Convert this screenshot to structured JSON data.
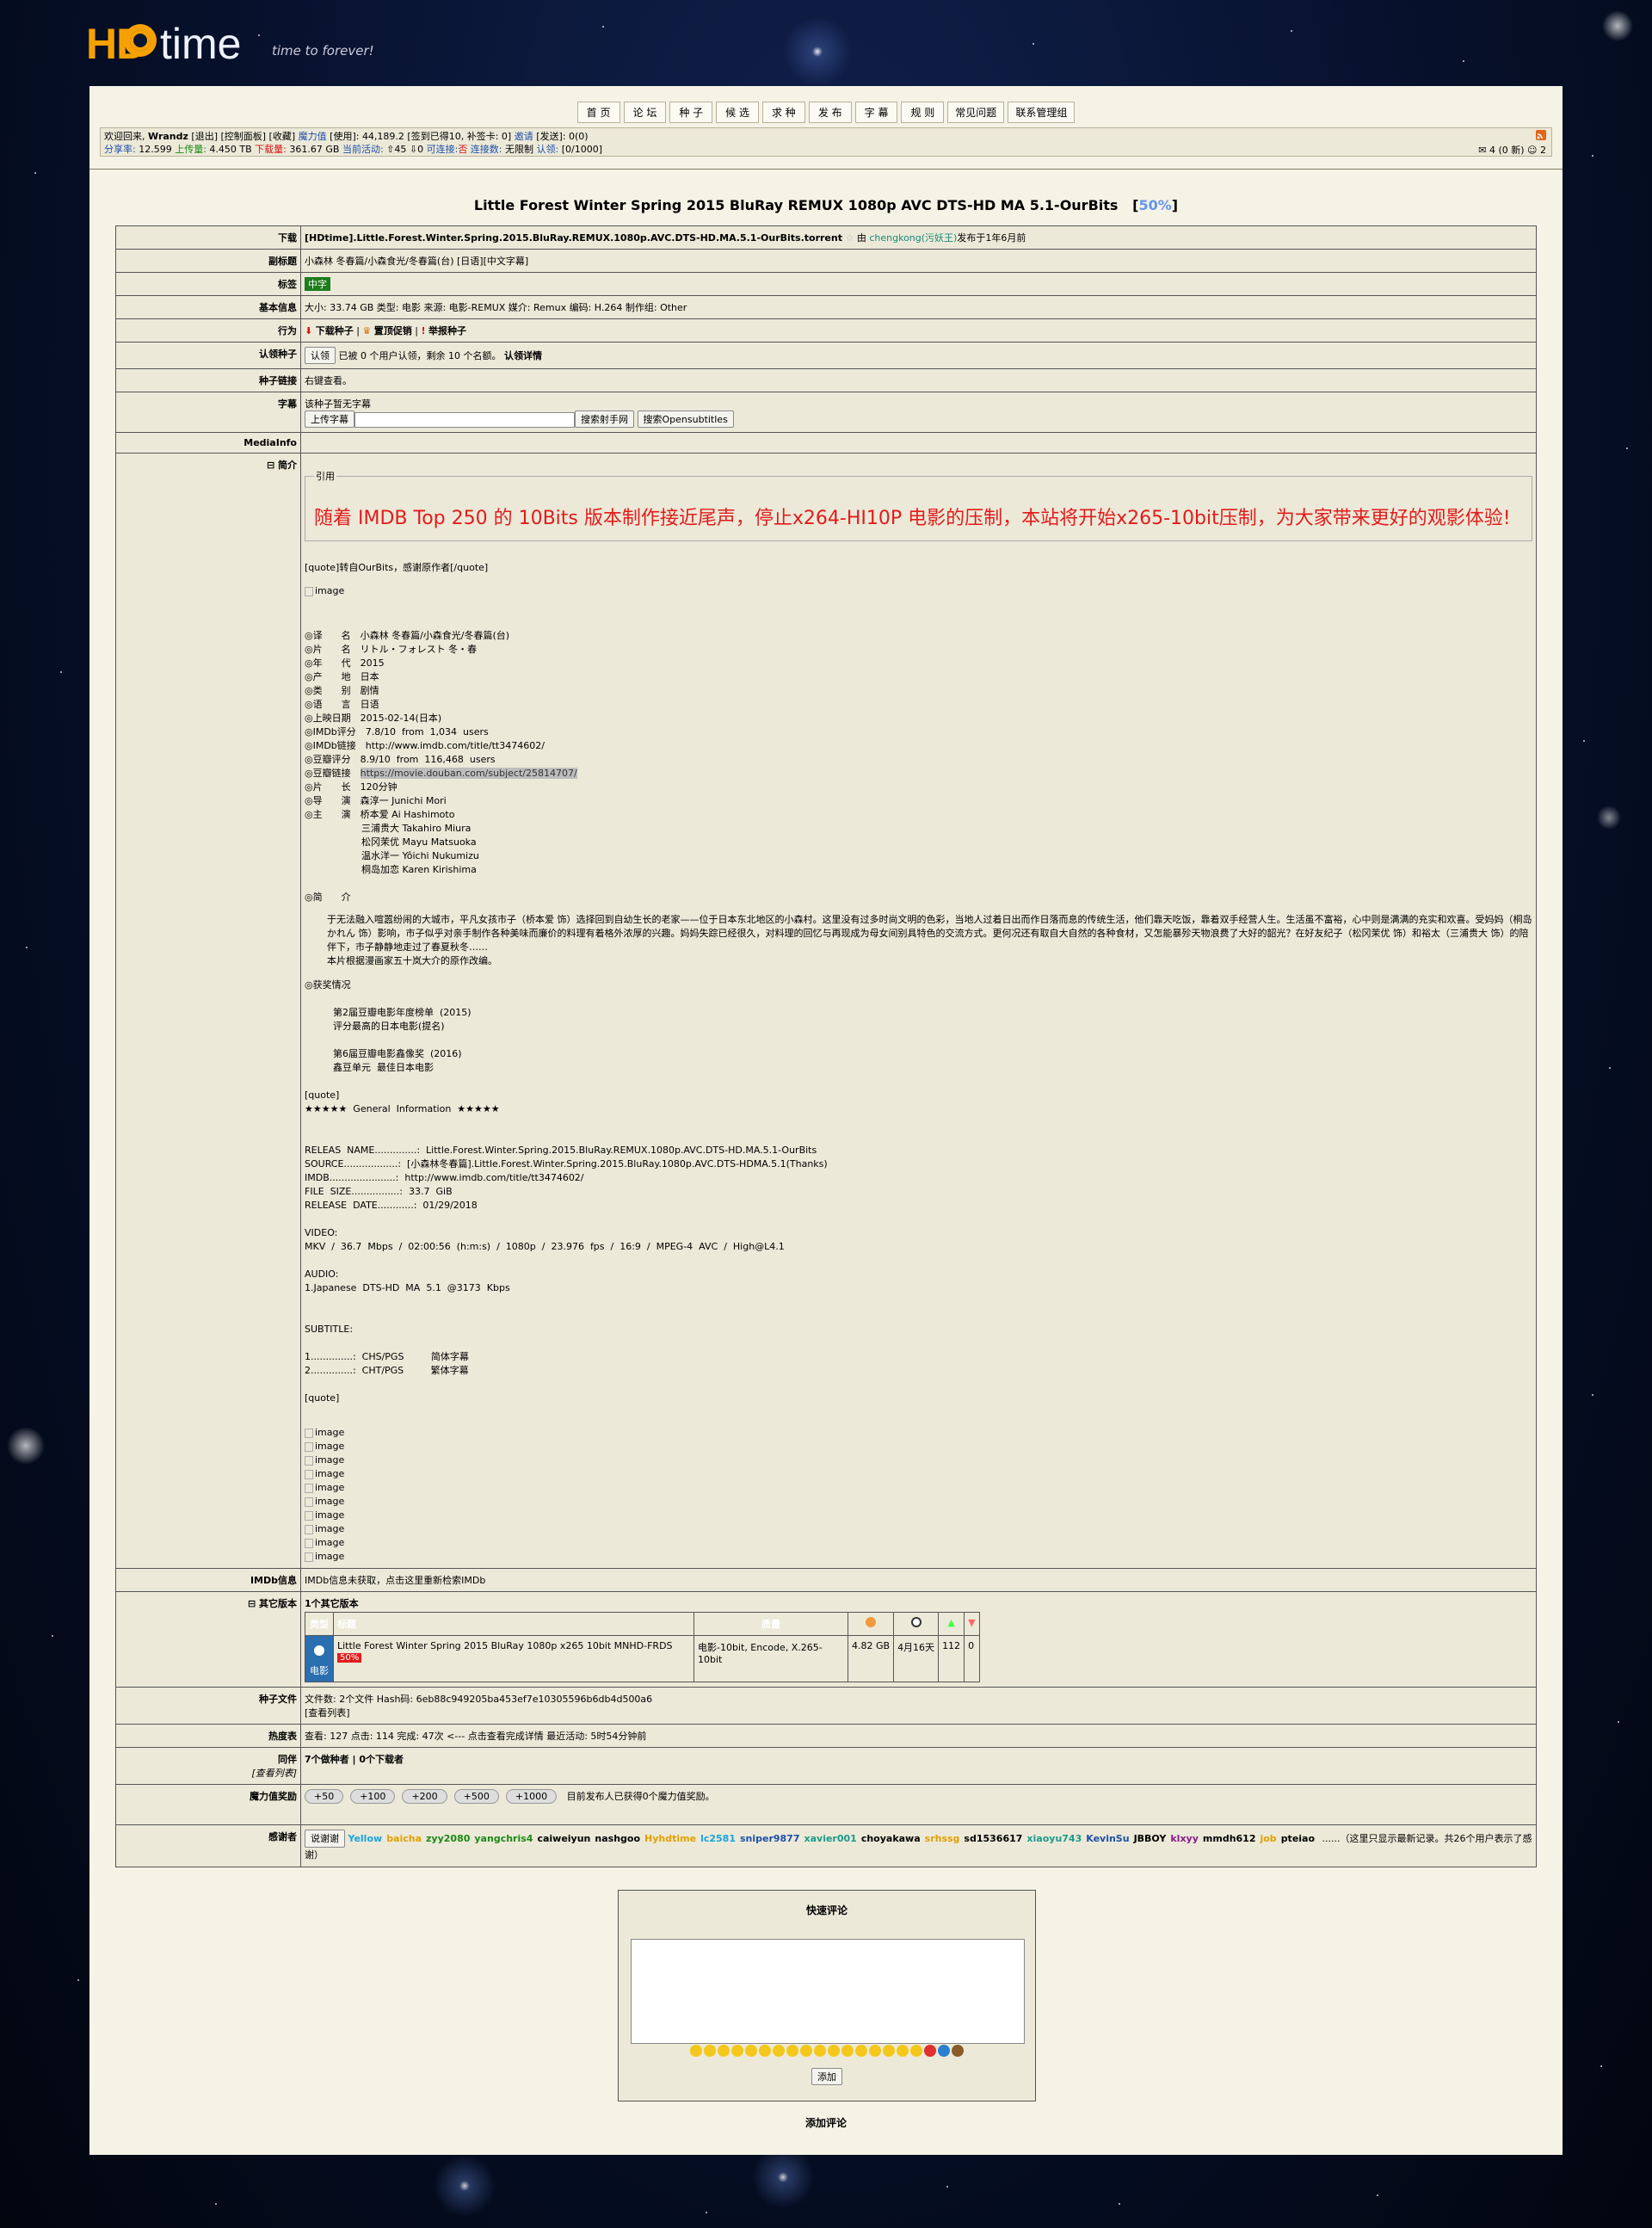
{
  "logo": {
    "brand_a": "HD",
    "brand_b": "time",
    "slogan": "time to forever!"
  },
  "nav": [
    "首 页",
    "论 坛",
    "种 子",
    "候 选",
    "求 种",
    "发 布",
    "字 幕",
    "规 则",
    "常见问题",
    "联系管理组"
  ],
  "userbar": {
    "line1": [
      {
        "t": "欢迎回来, ",
        "c": ""
      },
      {
        "t": "Wrandz",
        "c": "b"
      },
      {
        "t": " [退出] [控制面板] [收藏] ",
        "c": ""
      },
      {
        "t": "魔力值",
        "c": "blue"
      },
      {
        "t": " [使用]: 44,189.2 [签到已得10, 补签卡: 0] ",
        "c": ""
      },
      {
        "t": "邀请",
        "c": "blue"
      },
      {
        "t": " [发送]: 0(0)",
        "c": ""
      }
    ],
    "line2": [
      {
        "t": "分享率:",
        "c": "blue"
      },
      {
        "t": " 12.599 ",
        "c": ""
      },
      {
        "t": "上传量:",
        "c": "green"
      },
      {
        "t": " 4.450 TB ",
        "c": ""
      },
      {
        "t": "下载量:",
        "c": "red"
      },
      {
        "t": " 361.67 GB ",
        "c": ""
      },
      {
        "t": "当前活动:",
        "c": "blue"
      },
      {
        "t": " ⇧45 ⇩0   ",
        "c": ""
      },
      {
        "t": "可连接:",
        "c": "blue"
      },
      {
        "t": "否",
        "c": "red"
      },
      {
        "t": " 连接数:",
        "c": "blue"
      },
      {
        "t": " 无限制 ",
        "c": ""
      },
      {
        "t": "认领:",
        "c": "blue"
      },
      {
        "t": " [0/1000]",
        "c": ""
      }
    ],
    "messages": "4 (0 新)",
    "friends": "2"
  },
  "torrent": {
    "title": "Little Forest Winter Spring 2015 BluRay REMUX 1080p AVC DTS-HD MA 5.1-OurBits",
    "promo": "50%",
    "rows": {
      "download_label": "下载",
      "download_file": "[HDtime].Little.Forest.Winter.Spring.2015.BluRay.REMUX.1080p.AVC.DTS-HD.MA.5.1-OurBits.torrent",
      "uploader_pre": "由",
      "uploader": "chengkong",
      "uploader_class": "(污妖王)",
      "uploader_post": "发布于1年6月前",
      "subtitle_label": "副标题",
      "subtitle": "小森林 冬春篇/小森食光/冬春篇(台) [日语][中文字幕]",
      "tags_label": "标签",
      "tag": "中字",
      "basic_label": "基本信息",
      "basic": "大小: 33.74 GB   类型: 电影   来源: 电影-REMUX   媒介: Remux   编码: H.264   制作组: Other",
      "action_label": "行为",
      "act_download": "下载种子",
      "act_sticky": "置顶促销",
      "act_report": "举报种子",
      "claim_label": "认领种子",
      "claim_btn": "认领",
      "claim_text": "已被 0 个用户认领，剩余 10 个名额。",
      "claim_detail": "认领详情",
      "link_label": "种子链接",
      "link_text": "右键查看。",
      "subs_label": "字幕",
      "subs_none": "该种子暂无字幕",
      "subs_upload": "上传字幕",
      "subs_search1": "搜索射手网",
      "subs_search2": "搜索Opensubtitles",
      "mediainfo_label": "MediaInfo",
      "intro_label": "⊟ 简介",
      "imdb_label": "IMDb信息",
      "imdb_text": "IMDb信息未获取，点击",
      "imdb_link": "这里重新检索IMDb",
      "other_label": "⊟ 其它版本",
      "other_count": "1个其它版本",
      "files_label": "种子文件",
      "files_text": "文件数: 2个文件     Hash码: 6eb88c949205ba453ef7e10305596b6db4d500a6",
      "files_list": "[查看列表]",
      "heat_label": "热度表",
      "heat_text": "查看: 127    点击: 114    完成: 47次 <--- 点击查看完成详情    最近活动: 5时54分钟前",
      "peers_label": "同伴",
      "peers_sub": "[查看列表]",
      "peers_text": "7个做种者 | 0个下载者",
      "bonus_label": "魔力值奖励",
      "bonus_btns": [
        "+50",
        "+100",
        "+200",
        "+500",
        "+1000"
      ],
      "bonus_text": "目前发布人已获得0个魔力值奖励。",
      "thanks_label": "感谢者",
      "thanks_btn": "说谢谢",
      "thanks_note": "......（这里只显示最新记录。共26个用户表示了感谢）"
    },
    "quote_legend": "引用",
    "quote_text": "随着 IMDB Top 250 的 10Bits 版本制作接近尾声，停止x264-HI10P 电影的压制，本站将开始x265-10bit压制，为大家带来更好的观影体验!",
    "desc_pre": "[quote]转自OurBits，感谢原作者[/quote]",
    "image_alt": "image",
    "info_block": "◎译　　名　小森林 冬春篇/小森食光/冬春篇(台)\n◎片　　名　リトル・フォレスト 冬・春\n◎年　　代　2015\n◎产　　地　日本\n◎类　　别　剧情\n◎语　　言　日语\n◎上映日期　2015-02-14(日本)\n◎IMDb评分　7.8/10  from  1,034  users\n◎IMDb链接　http://www.imdb.com/title/tt3474602/\n◎豆瓣评分　8.9/10  from  116,468  users",
    "douban_label": "◎豆瓣链接　",
    "douban_link": "https://movie.douban.com/subject/25814707/",
    "info_block2": "◎片　　长　120分钟\n◎导　　演　森淳一 Junichi Mori\n◎主　　演　桥本爱 Ai Hashimoto\n　　　　　　三浦贵大 Takahiro Miura\n　　　　　　松冈茉优 Mayu Matsuoka\n　　　　　　温水洋一 Yôichi Nukumizu\n　　　　　　桐岛加恋 Karen Kirishima\n\n◎简　　介",
    "plot": "于无法融入喧嚣纷闹的大城市，平凡女孩市子（桥本爱 饰）选择回到自幼生长的老家——位于日本东北地区的小森村。这里没有过多时尚文明的色彩，当地人过着日出而作日落而息的传统生活，他们靠天吃饭，靠着双手经营人生。生活虽不富裕，心中则是满满的充实和欢喜。受妈妈（桐岛かれん 饰）影响，市子似乎对亲手制作各种美味而廉价的料理有着格外浓厚的兴趣。妈妈失踪已经很久，对料理的回忆与再现成为母女间别具特色的交流方式。更何况还有取自大自然的各种食材，又怎能暴殄天物浪费了大好的韶光？在好友纪子（松冈茉优 饰）和裕太（三浦贵大 饰）的陪伴下，市子静静地走过了春夏秋冬……\n本片根据漫画家五十岚大介的原作改编。",
    "awards_block": "◎获奖情况\n\n　　　第2届豆瓣电影年度榜单  (2015)\n　　　评分最高的日本电影(提名)\n\n　　　第6届豆瓣电影鑫像奖  (2016)\n　　　鑫豆单元  最佳日本电影\n\n[quote]\n★★★★★  General  Information  ★★★★★\n\n\nRELEAS  NAME..............:  Little.Forest.Winter.Spring.2015.BluRay.REMUX.1080p.AVC.DTS-HD.MA.5.1-OurBits\nSOURCE..................:  [小森林冬春篇].Little.Forest.Winter.Spring.2015.BluRay.1080p.AVC.DTS-HDMA.5.1(Thanks)\nIMDB......................:  http://www.imdb.com/title/tt3474602/\nFILE  SIZE................:  33.7  GiB\nRELEASE  DATE............:  01/29/2018\n\nVIDEO:\nMKV  /  36.7  Mbps  /  02:00:56  (h:m:s)  /  1080p  /  23.976  fps  /  16:9  /  MPEG-4  AVC  /  High@L4.1\n\nAUDIO:\n1.Japanese  DTS-HD  MA  5.1  @3173  Kbps\n\n\nSUBTITLE:\n\n1..............:  CHS/PGS         简体字幕\n2..............:  CHT/PGS         繁体字幕\n\n[quote]",
    "other_table": {
      "headers": [
        "类型",
        "标题",
        "质量"
      ],
      "type_text": "电影",
      "row_title": "Little Forest Winter Spring 2015 BluRay 1080p x265 10bit MNHD-FRDS",
      "row_free": "50%",
      "row_quality": "电影-10bit, Encode, X.265-10bit",
      "row_size": "4.82 GB",
      "row_time": "4月16天",
      "row_seeders": "112",
      "row_leechers": "0"
    },
    "thanks_users": [
      {
        "n": "Yellow",
        "c": "#1aa3e0"
      },
      {
        "n": "baicha",
        "c": "#e2a000"
      },
      {
        "n": "zyy2080",
        "c": "#1a8a14"
      },
      {
        "n": "yangchris4",
        "c": "#1a8a14"
      },
      {
        "n": "caiweiyun",
        "c": "#000"
      },
      {
        "n": "nashgoo",
        "c": "#000"
      },
      {
        "n": "Hyhdtime",
        "c": "#e2a000"
      },
      {
        "n": "lc2581",
        "c": "#1aa3e0"
      },
      {
        "n": "sniper9877",
        "c": "#1d4faa"
      },
      {
        "n": "xavier001",
        "c": "#1a9a8a"
      },
      {
        "n": "choyakawa",
        "c": "#000"
      },
      {
        "n": "srhssg",
        "c": "#e2a000"
      },
      {
        "n": "sd1536617",
        "c": "#000"
      },
      {
        "n": "xiaoyu743",
        "c": "#1a9a8a"
      },
      {
        "n": "KevinSu",
        "c": "#1d4faa"
      },
      {
        "n": "JBBOY",
        "c": "#000"
      },
      {
        "n": "klxyy",
        "c": "#8a1a8a"
      },
      {
        "n": "mmdh612",
        "c": "#000"
      },
      {
        "n": "job",
        "c": "#e2a000"
      },
      {
        "n": "pteiao",
        "c": "#000"
      }
    ]
  },
  "comment": {
    "title": "快速评论",
    "add_btn": "添加",
    "add_link": "添加评论"
  }
}
